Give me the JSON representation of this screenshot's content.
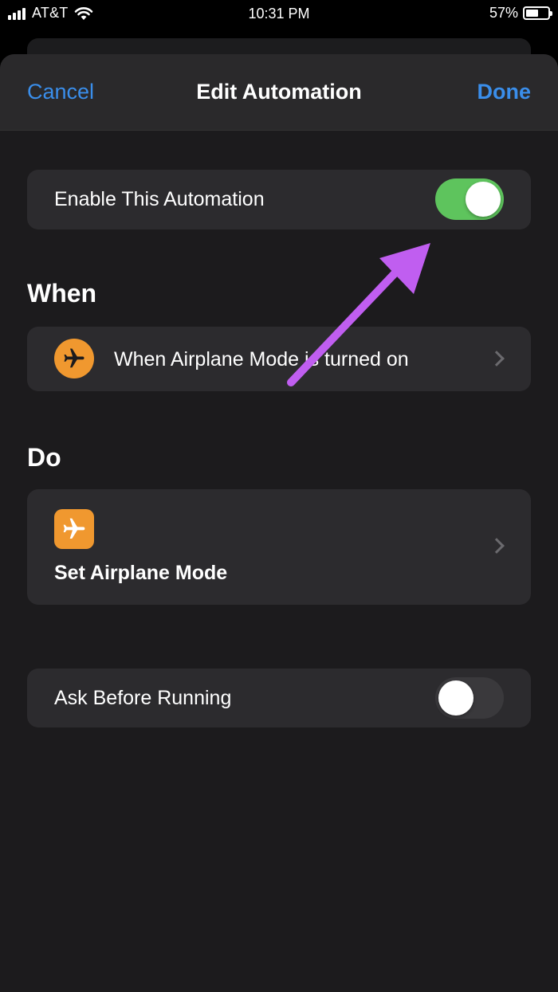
{
  "status_bar": {
    "carrier": "AT&T",
    "time": "10:31 PM",
    "battery_percent": "57%",
    "battery_level": 0.57
  },
  "nav": {
    "cancel_label": "Cancel",
    "title": "Edit Automation",
    "done_label": "Done"
  },
  "enable_row": {
    "label": "Enable This Automation",
    "toggle_on": true
  },
  "when_section": {
    "title": "When",
    "trigger_label": "When Airplane Mode is turned on",
    "icon": "airplane-icon"
  },
  "do_section": {
    "title": "Do",
    "action_label": "Set Airplane Mode",
    "icon": "airplane-icon"
  },
  "ask_row": {
    "label": "Ask Before Running",
    "toggle_on": false
  },
  "colors": {
    "accent": "#3a8eeb",
    "toggle_on": "#5ec45d",
    "icon_bg": "#f0982f",
    "annotation_arrow": "#c05ef0"
  }
}
